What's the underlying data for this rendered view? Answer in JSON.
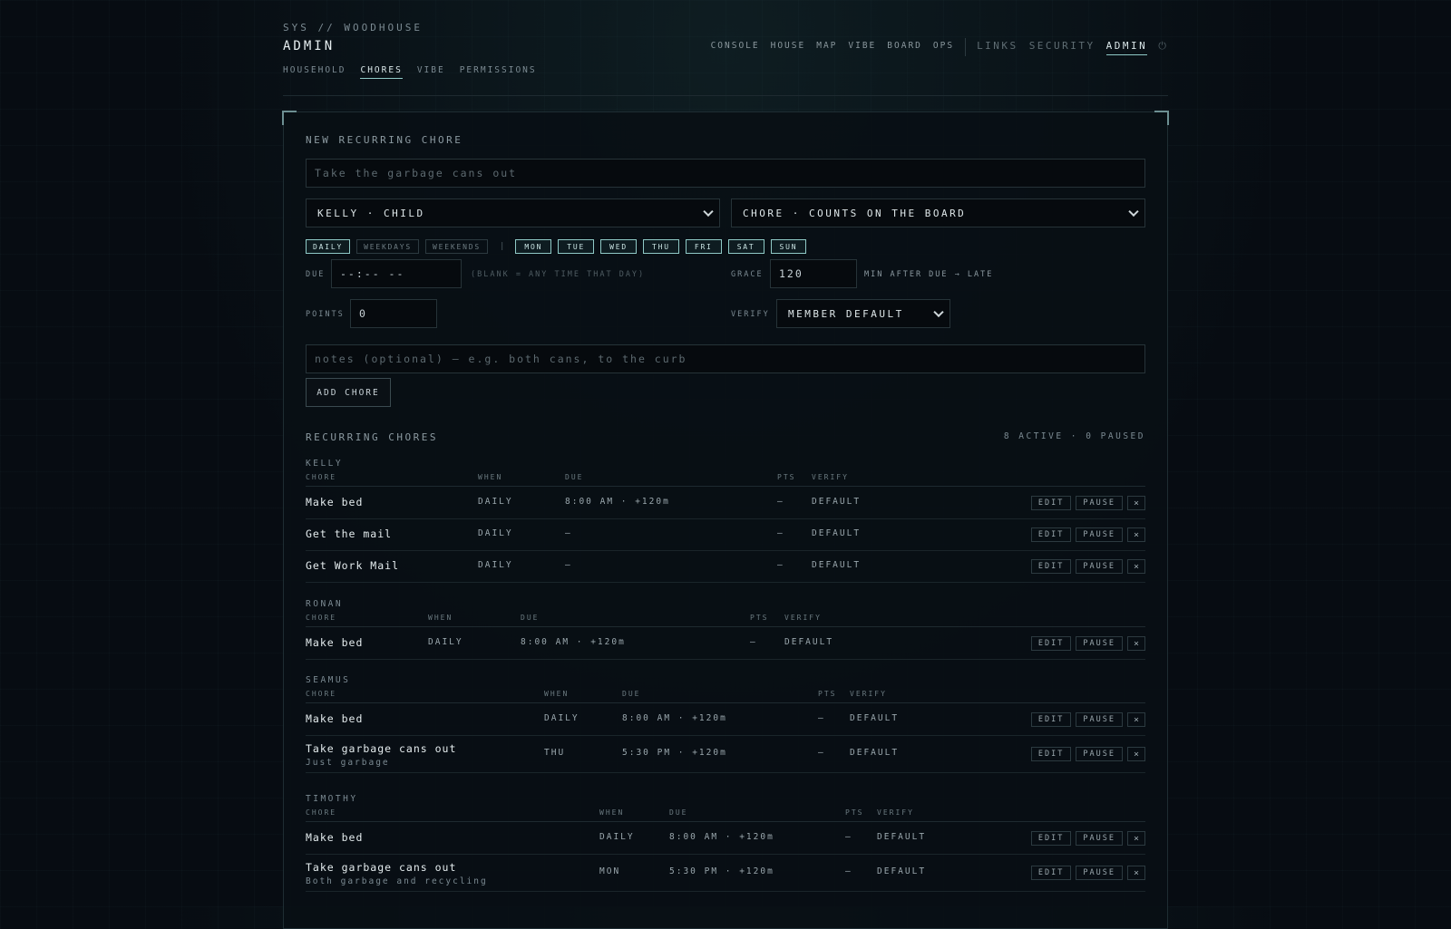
{
  "brand": {
    "sys": "SYS // WOODHOUSE",
    "title": "ADMIN"
  },
  "subnav": [
    "HOUSEHOLD",
    "CHORES",
    "VIBE",
    "PERMISSIONS"
  ],
  "topnav": {
    "main": [
      "CONSOLE",
      "HOUSE",
      "MAP",
      "VIBE",
      "BOARD",
      "OPS"
    ],
    "links": "LINKS",
    "security": "SECURITY",
    "admin": "ADMIN",
    "power_icon": "⏻"
  },
  "form": {
    "section_title": "NEW RECURRING CHORE",
    "chore_placeholder": "Take the garbage cans out",
    "member_select": "KELLY · CHILD",
    "type_select": "CHORE · COUNTS ON THE BOARD",
    "presets": [
      "DAILY",
      "WEEKDAYS",
      "WEEKENDS"
    ],
    "pipe": "|",
    "days": [
      "MON",
      "TUE",
      "WED",
      "THU",
      "FRI",
      "SAT",
      "SUN"
    ],
    "due_label": "DUE",
    "due_value": "--:-- --",
    "due_hint": "(BLANK = ANY TIME THAT DAY)",
    "grace_label": "GRACE",
    "grace_value": "120",
    "grace_hint": "MIN AFTER DUE → LATE",
    "points_label": "POINTS",
    "points_value": "0",
    "verify_label": "VERIFY",
    "verify_select": "MEMBER DEFAULT",
    "notes_placeholder": "notes (optional) — e.g. both cans, to the curb",
    "add_button": "ADD CHORE"
  },
  "list": {
    "title": "RECURRING CHORES",
    "summary": "8 ACTIVE · 0 PAUSED",
    "headers": {
      "chore": "CHORE",
      "when": "WHEN",
      "due": "DUE",
      "pts": "PTS",
      "verify": "VERIFY"
    },
    "actions": {
      "edit": "EDIT",
      "pause": "PAUSE",
      "delete": "×"
    },
    "groups": [
      {
        "name": "KELLY",
        "rows": [
          {
            "chore": "Make bed",
            "note": "",
            "when": "DAILY",
            "due": "8:00 AM · +120m",
            "pts": "—",
            "verify": "DEFAULT"
          },
          {
            "chore": "Get the mail",
            "note": "",
            "when": "DAILY",
            "due": "—",
            "pts": "—",
            "verify": "DEFAULT"
          },
          {
            "chore": "Get Work Mail",
            "note": "",
            "when": "DAILY",
            "due": "—",
            "pts": "—",
            "verify": "DEFAULT"
          }
        ]
      },
      {
        "name": "RONAN",
        "rows": [
          {
            "chore": "Make bed",
            "note": "",
            "when": "DAILY",
            "due": "8:00 AM · +120m",
            "pts": "—",
            "verify": "DEFAULT"
          }
        ]
      },
      {
        "name": "SEAMUS",
        "rows": [
          {
            "chore": "Make bed",
            "note": "",
            "when": "DAILY",
            "due": "8:00 AM · +120m",
            "pts": "—",
            "verify": "DEFAULT"
          },
          {
            "chore": "Take garbage cans out",
            "note": "Just garbage",
            "when": "THU",
            "due": "5:30 PM · +120m",
            "pts": "—",
            "verify": "DEFAULT"
          }
        ]
      },
      {
        "name": "TIMOTHY",
        "rows": [
          {
            "chore": "Make bed",
            "note": "",
            "when": "DAILY",
            "due": "8:00 AM · +120m",
            "pts": "—",
            "verify": "DEFAULT"
          },
          {
            "chore": "Take garbage cans out",
            "note": "Both garbage and recycling",
            "when": "MON",
            "due": "5:30 PM · +120m",
            "pts": "—",
            "verify": "DEFAULT"
          }
        ]
      }
    ]
  }
}
